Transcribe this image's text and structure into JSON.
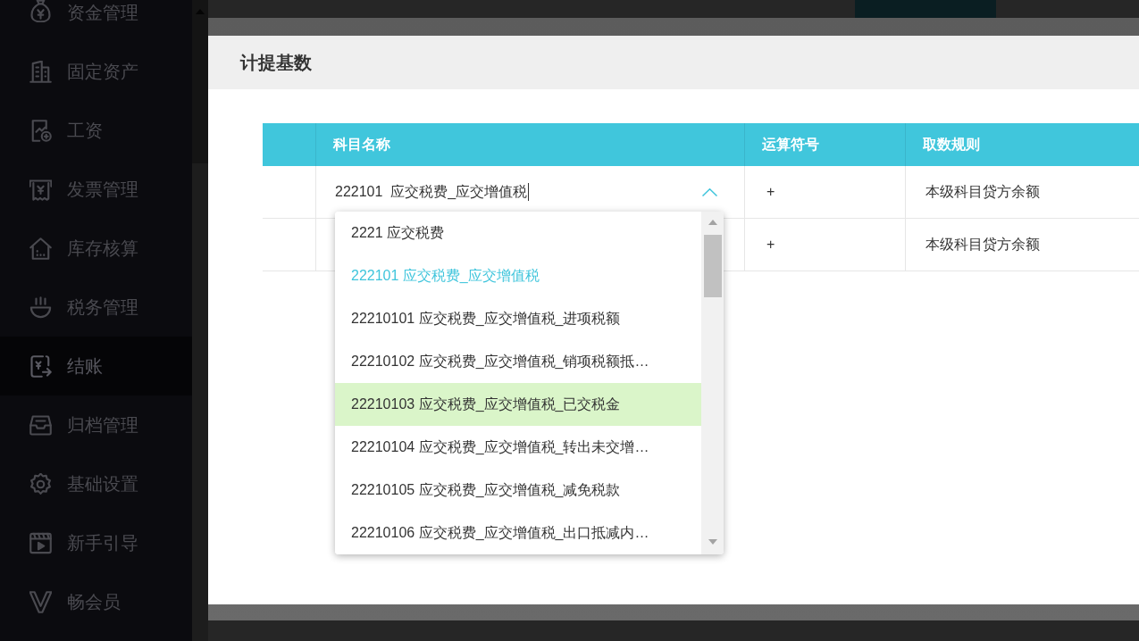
{
  "sidebar": {
    "items": [
      {
        "label": "资金管理",
        "selected": false
      },
      {
        "label": "固定资产",
        "selected": false
      },
      {
        "label": "工资",
        "selected": false
      },
      {
        "label": "发票管理",
        "selected": false
      },
      {
        "label": "库存核算",
        "selected": false
      },
      {
        "label": "税务管理",
        "selected": false
      },
      {
        "label": "结账",
        "selected": true
      },
      {
        "label": "归档管理",
        "selected": false
      },
      {
        "label": "基础设置",
        "selected": false
      },
      {
        "label": "新手引导",
        "selected": false
      },
      {
        "label": "畅会员",
        "selected": false
      }
    ]
  },
  "dialog": {
    "title": "计提基数",
    "table": {
      "columns": [
        {
          "label": "科目名称"
        },
        {
          "label": "运算符号"
        },
        {
          "label": "取数规则"
        }
      ],
      "rows": [
        {
          "account": {
            "value": "222101  应交税费_应交增值税",
            "focused": true,
            "expanded": true,
            "options": [
              {
                "label": "2221 应交税费",
                "selected": false,
                "hovered": false
              },
              {
                "label": "222101 应交税费_应交增值税",
                "selected": true,
                "hovered": false
              },
              {
                "label": "22210101 应交税费_应交增值税_进项税额",
                "selected": false,
                "hovered": false
              },
              {
                "label": "22210102 应交税费_应交增值税_销项税额抵…",
                "selected": false,
                "hovered": false
              },
              {
                "label": "22210103 应交税费_应交增值税_已交税金",
                "selected": false,
                "hovered": true
              },
              {
                "label": "22210104 应交税费_应交增值税_转出未交增…",
                "selected": false,
                "hovered": false
              },
              {
                "label": "22210105 应交税费_应交增值税_减免税款",
                "selected": false,
                "hovered": false
              },
              {
                "label": "22210106 应交税费_应交增值税_出口抵减内…",
                "selected": false,
                "hovered": false
              }
            ]
          },
          "operator": "+",
          "rule": "本级科目贷方余额"
        },
        {
          "operator": "+",
          "rule": "本级科目贷方余额"
        }
      ]
    }
  }
}
